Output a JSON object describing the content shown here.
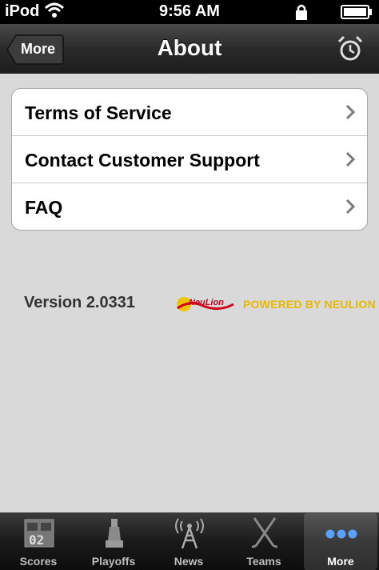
{
  "statusbar": {
    "carrier": "iPod",
    "time": "9:56 AM"
  },
  "navbar": {
    "back_label": "More",
    "title": "About"
  },
  "menu": [
    {
      "label": "Terms of Service"
    },
    {
      "label": "Contact Customer Support"
    },
    {
      "label": "FAQ"
    }
  ],
  "footer": {
    "version": "Version 2.0331",
    "powered_by": "POWERED BY NEULION",
    "logo_text": "NeuLion"
  },
  "tabbar": [
    {
      "label": "Scores",
      "icon": "scoreboard-icon"
    },
    {
      "label": "Playoffs",
      "icon": "trophy-icon"
    },
    {
      "label": "News",
      "icon": "antenna-icon"
    },
    {
      "label": "Teams",
      "icon": "hockey-sticks-icon"
    },
    {
      "label": "More",
      "icon": "more-dots-icon"
    }
  ],
  "colors": {
    "accent_active_dots": "#5aa0ff",
    "powered_text": "#e8b800",
    "logo_red": "#d0001a"
  }
}
